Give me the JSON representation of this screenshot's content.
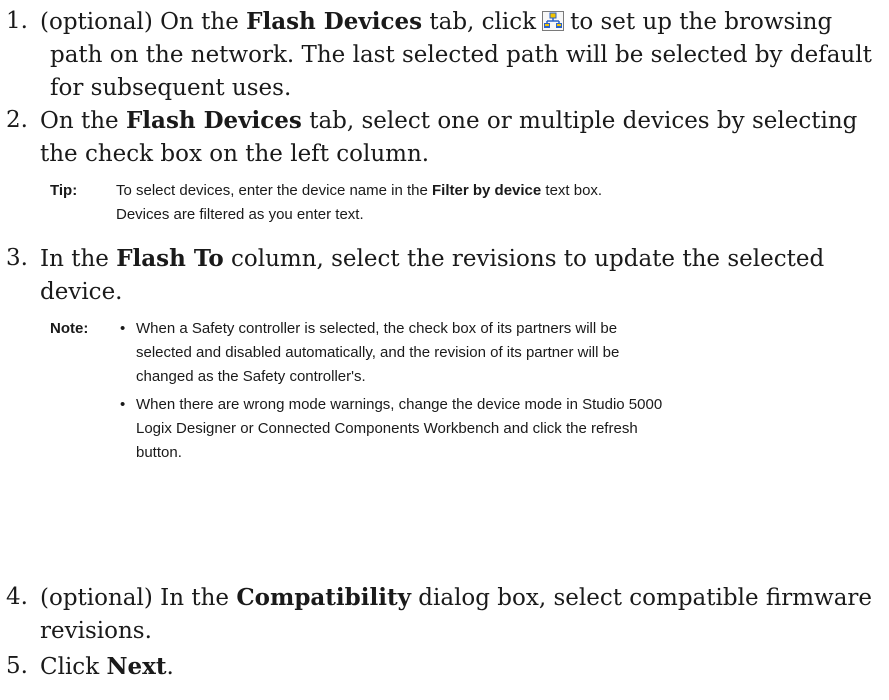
{
  "steps": [
    {
      "num": "1.",
      "pre": "(optional) On the",
      "bold": "Flash Devices",
      "mid": "tab, click",
      "icon": "network-browse-icon",
      "post": "to set up the browsing",
      "line2": "path on the network. The last selected path will be selected by default",
      "line3": "for subsequent uses."
    },
    {
      "num": "2.",
      "pre": "On the",
      "bold": "Flash Devices",
      "post": "tab, select one or multiple devices by selecting",
      "line2": "the check box on the left column."
    },
    {
      "num": "3.",
      "pre": "In the",
      "bold": "Flash To",
      "post": "column, select the revisions to update the selected",
      "line2": "device."
    },
    {
      "num": "4.",
      "pre": "(optional) In the",
      "bold": "Compatibility",
      "post": "dialog box, select compatible firmware",
      "line2": "revisions."
    },
    {
      "num": "5.",
      "pre": "Click",
      "bold": "Next",
      "post": "."
    }
  ],
  "tip": {
    "label": "Tip:",
    "pre": "To select devices, enter the device name in the",
    "bold": "Filter by device",
    "post": "text box.",
    "line2": "Devices are filtered as you enter text."
  },
  "note": {
    "label": "Note:",
    "bullet": "•",
    "b1_l1": "When a Safety controller is selected, the check box of its partners will be",
    "b1_l2": "selected and disabled automatically, and the revision of its partner will be",
    "b1_l3": "changed as the Safety controller's.",
    "b2_l1": "When there are wrong mode warnings, change the device mode in Studio 5000",
    "b2_l2": "Logix Designer or Connected Components Workbench and click the refresh",
    "b2_l3": "button."
  },
  "colors": {
    "icon_blue": "#2a62c9",
    "icon_yellow": "#f2c300",
    "icon_frame": "#7a7a7a"
  }
}
